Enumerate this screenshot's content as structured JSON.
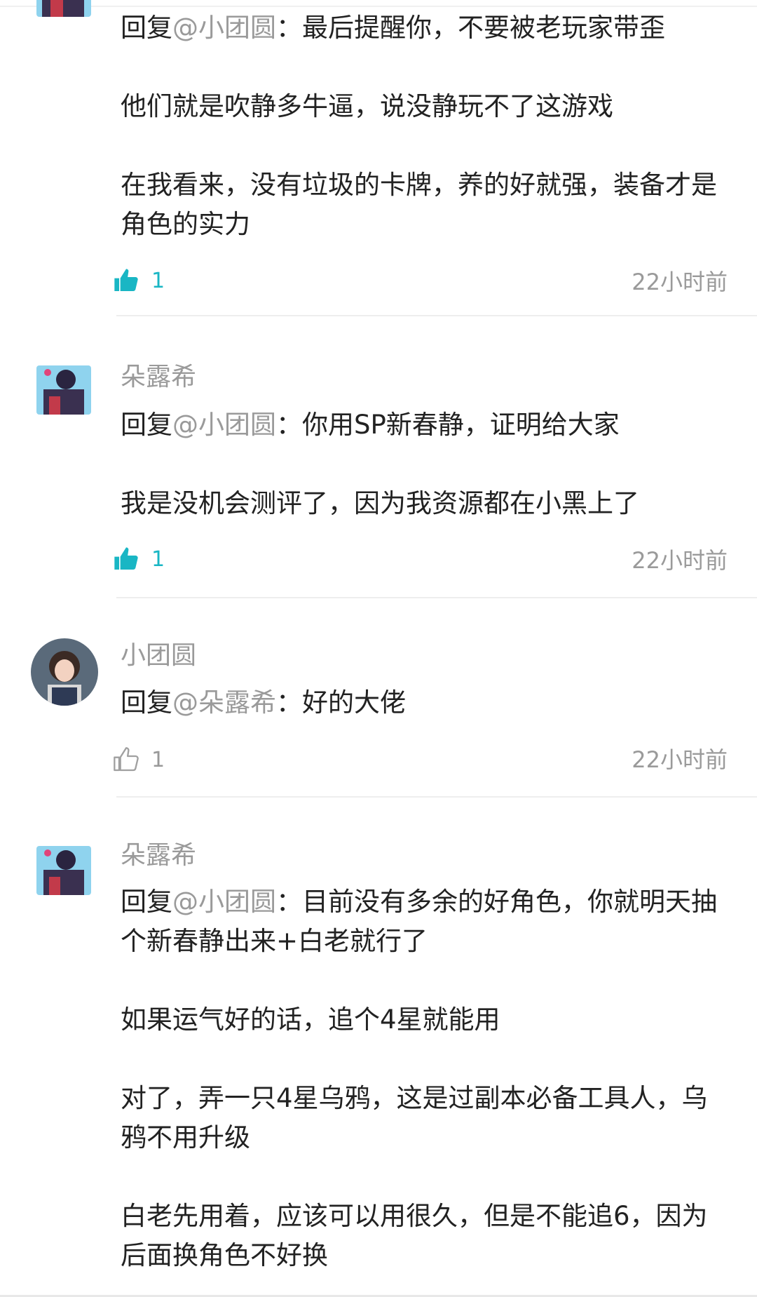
{
  "comments": [
    {
      "reply_prefix": "回复",
      "mention": "@小团圆",
      "reply_rest": "：最后提醒你，不要被老玩家带歪",
      "paragraphs": [
        "他们就是吹静多牛逼，说没静玩不了这游戏",
        "在我看来，没有垃圾的卡牌，养的好就强，装备才是角色的实力"
      ],
      "likes": "1",
      "time": "22小时前"
    },
    {
      "username": "朵露希",
      "reply_prefix": "回复",
      "mention": "@小团圆",
      "reply_rest": "：你用SP新春静，证明给大家",
      "paragraphs": [
        "我是没机会测评了，因为我资源都在小黑上了"
      ],
      "likes": "1",
      "time": "22小时前"
    },
    {
      "username": "小团圆",
      "reply_prefix": "回复",
      "mention": "@朵露希",
      "reply_rest": "：好的大佬",
      "likes": "1",
      "time": "22小时前"
    },
    {
      "username": "朵露希",
      "reply_prefix": "回复",
      "mention": "@小团圆",
      "reply_rest": "：目前没有多余的好角色，你就明天抽个新春静出来+白老就行了",
      "paragraphs": [
        "如果运气好的话，追个4星就能用",
        "对了，弄一只4星乌鸦，这是过副本必备工具人，乌鸦不用升级",
        "白老先用着，应该可以用很久，但是不能追6，因为后面换角色不好换"
      ]
    }
  ],
  "colors": {
    "accent": "#19b6c4",
    "muted": "#9a9a9a",
    "text": "#222222"
  },
  "icons": {
    "like_active": "thumb-up-filled-icon",
    "like_inactive": "thumb-up-outline-icon"
  }
}
